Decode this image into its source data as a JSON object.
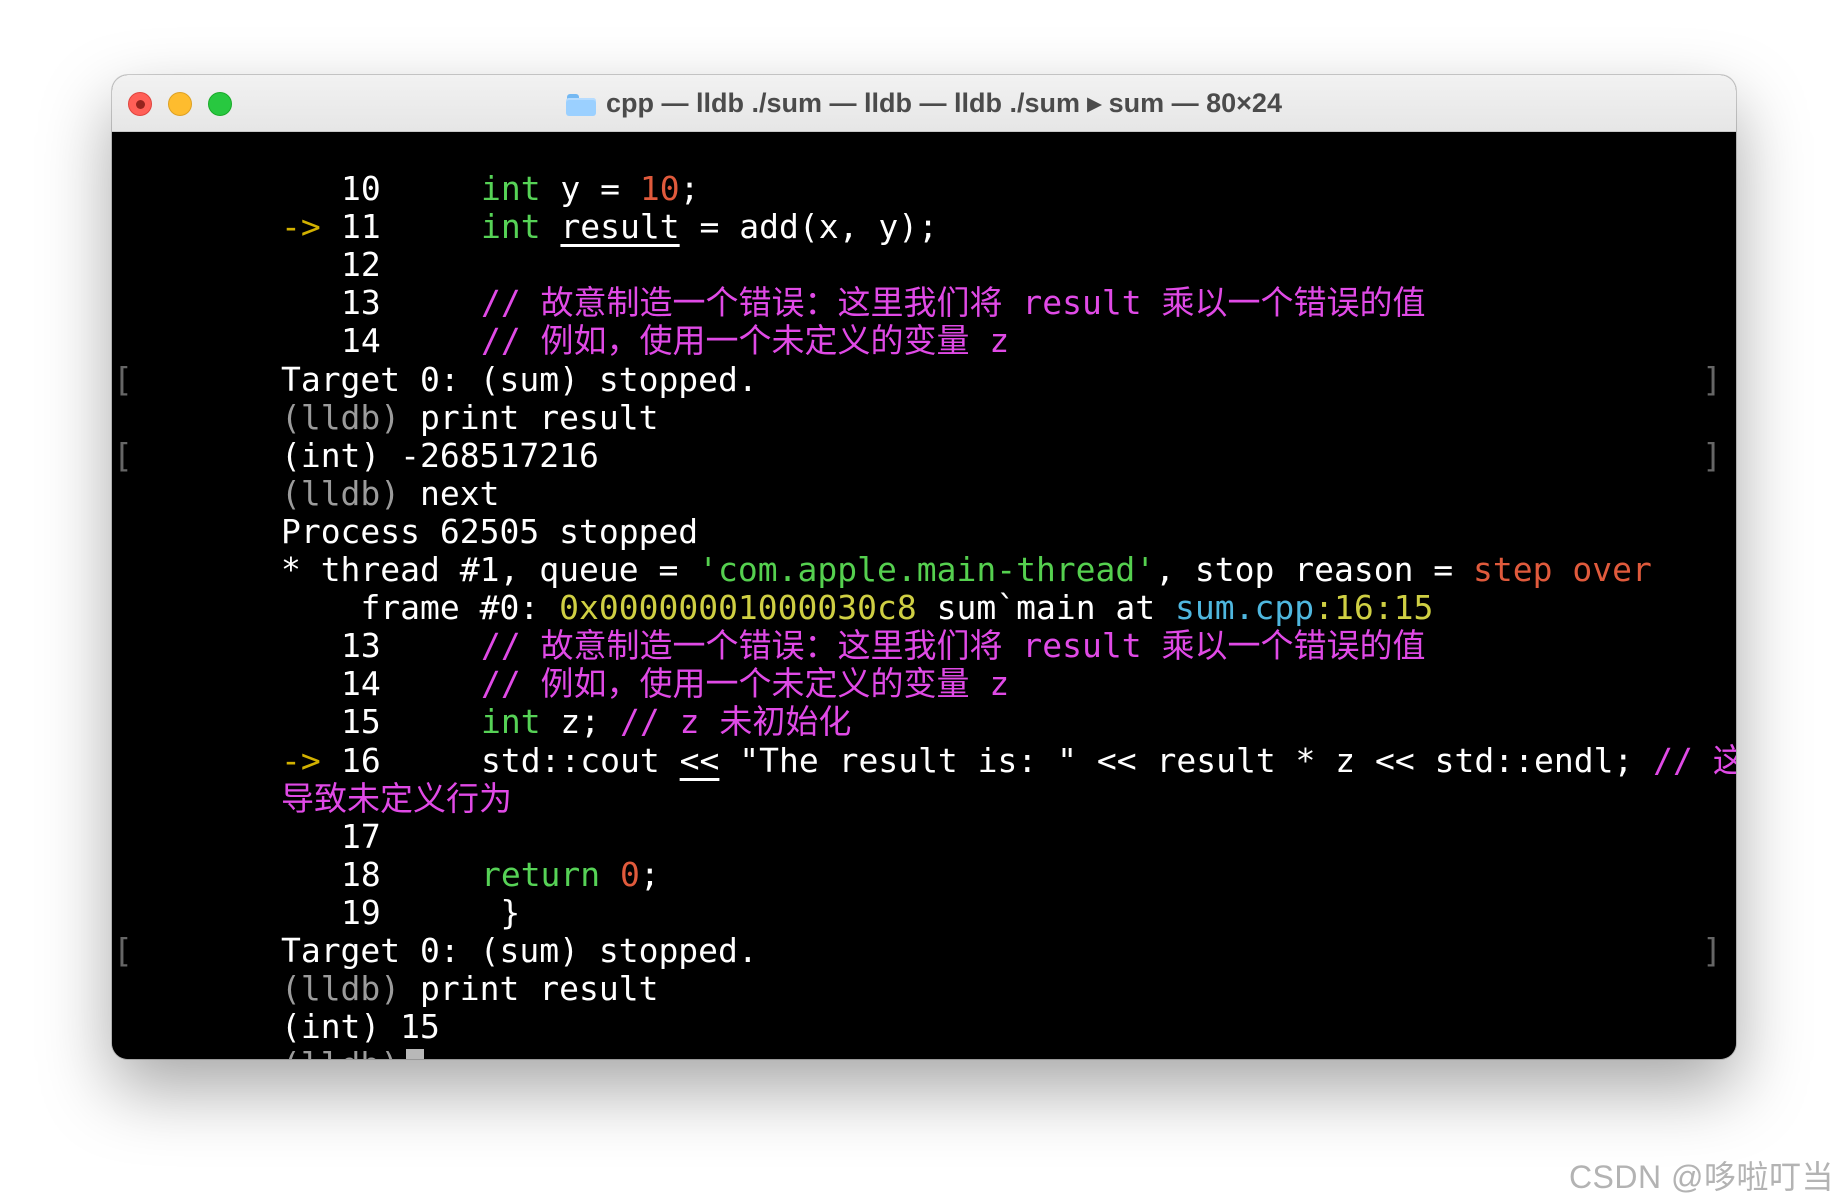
{
  "window": {
    "title": "cpp — lldb ./sum — lldb — lldb ./sum ▸ sum — 80×24",
    "title_icon": "folder-icon",
    "traffic_lights": {
      "close_color": "#ff5f57",
      "minimize_color": "#febc2e",
      "zoom_color": "#28c840"
    }
  },
  "terminal": {
    "colors": {
      "background": "#000000",
      "foreground": "#ffffff",
      "keyword": "#56d256",
      "number": "#e05a3c",
      "comment": "#e04ae6",
      "string": "#55d04f",
      "address": "#cfcf43",
      "file": "#4fb7df",
      "arrow": "#d2b100",
      "prompt": "#9b9b9b"
    },
    "lines": {
      "l1": {
        "num": "10",
        "kw": "int",
        "text": " y = ",
        "value": "10",
        "end": ";"
      },
      "l2": {
        "arrow": "->",
        "num": "11",
        "kw": "int",
        "var": "result",
        "text": " = add(x, y);"
      },
      "l3": {
        "num": "12"
      },
      "l4": {
        "num": "13",
        "comment": "// 故意制造一个错误：这里我们将 result 乘以一个错误的值"
      },
      "l5": {
        "num": "14",
        "comment": "// 例如，使用一个未定义的变量 z"
      },
      "l6": {
        "text": "Target 0: (sum) stopped."
      },
      "l7": {
        "prompt": "(lldb)",
        "command": "print result"
      },
      "l8": {
        "text": "(int) -268517216"
      },
      "l9": {
        "prompt": "(lldb)",
        "command": "next"
      },
      "l10": {
        "text": "Process 62505 stopped"
      },
      "l11": {
        "prefix": "* thread #1, queue = ",
        "queue": "'com.apple.main-thread'",
        "middle": ", stop reason = ",
        "reason": "step over"
      },
      "l12": {
        "prefix": "frame #0: ",
        "address": "0x00000001000030c8",
        "middle": " sum`main at ",
        "file": "sum.cpp",
        "line_col": ":16:15",
        "sep": ":"
      },
      "l13": {
        "num": "13",
        "comment": "// 故意制造一个错误：这里我们将 result 乘以一个错误的值"
      },
      "l14": {
        "num": "14",
        "comment": "// 例如，使用一个未定义的变量 z"
      },
      "l15": {
        "num": "15",
        "kw": "int",
        "text": " z; ",
        "comment": "// z 未初始化"
      },
      "l16": {
        "arrow": "->",
        "num": "16",
        "text_a": "std::cout ",
        "op": "<<",
        "text_b": " \"The result is: \" << result * z << std::endl; ",
        "comment": "// 这里会"
      },
      "l17": {
        "comment": "导致未定义行为"
      },
      "l18": {
        "num": "17"
      },
      "l19": {
        "num": "18",
        "kw": "return",
        "text": " ",
        "value": "0",
        "end": ";"
      },
      "l20": {
        "num": "19",
        "text": "    }"
      },
      "l21": {
        "text": "Target 0: (sum) stopped."
      },
      "l22": {
        "prompt": "(lldb)",
        "command": "print result"
      },
      "l23": {
        "text": "(int) 15"
      },
      "l24": {
        "prompt": "(lldb)"
      }
    }
  },
  "watermark": "CSDN @哆啦叮当"
}
